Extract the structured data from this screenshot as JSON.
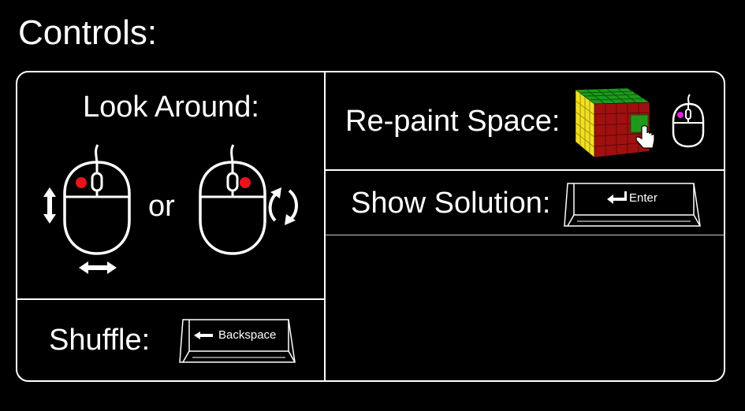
{
  "page": {
    "title": "Controls:"
  },
  "look_around": {
    "label": "Look Around:",
    "or_text": "or"
  },
  "repaint": {
    "label": "Re-paint Space:"
  },
  "show_solution": {
    "label": "Show Solution:",
    "key_label": "Enter"
  },
  "shuffle": {
    "label": "Shuffle:",
    "key_label": "Backspace"
  },
  "colors": {
    "background": "#000000",
    "foreground": "#ffffff",
    "mouse_button_dot": "#e8141c",
    "mouse_button_dot_alt": "#e020e0",
    "cube_red": "#a01010",
    "cube_green": "#1d9a1d",
    "cube_yellow": "#f0e020"
  }
}
